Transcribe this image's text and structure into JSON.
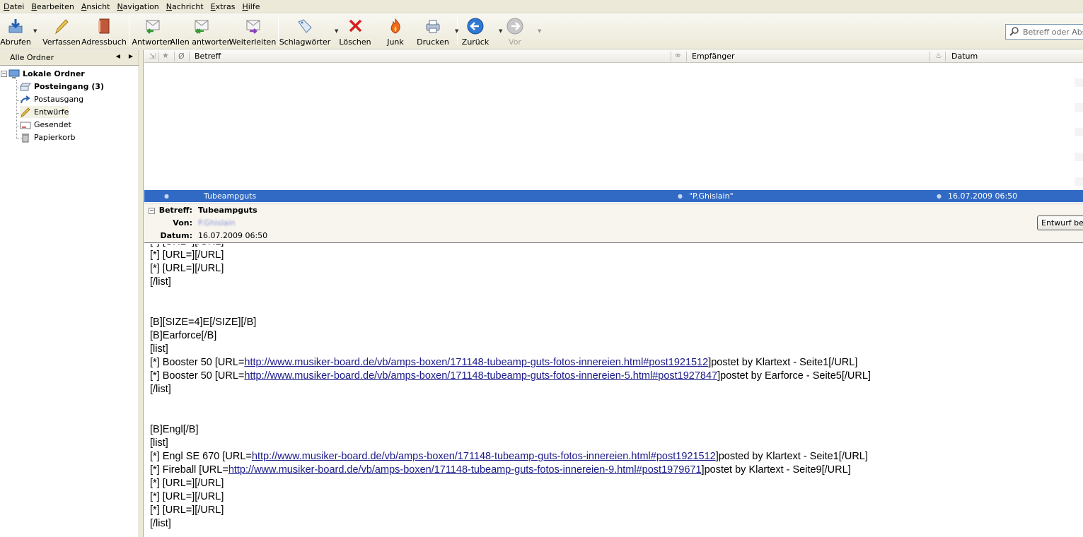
{
  "menu": [
    "Datei",
    "Bearbeiten",
    "Ansicht",
    "Navigation",
    "Nachricht",
    "Extras",
    "Hilfe"
  ],
  "toolbar": {
    "abrufen": "Abrufen",
    "verfassen": "Verfassen",
    "adressbuch": "Adressbuch",
    "antworten": "Antworten",
    "allen_antworten": "Allen antworten",
    "weiterleiten": "Weiterleiten",
    "schlagwoerter": "Schlagwörter",
    "loeschen": "Löschen",
    "junk": "Junk",
    "drucken": "Drucken",
    "zurueck": "Zurück",
    "vor": "Vor"
  },
  "search": {
    "placeholder": "Betreff oder Abs"
  },
  "folder_pane": {
    "header": "Alle Ordner",
    "root": "Lokale Ordner",
    "folders": [
      "Posteingang (3)",
      "Postausgang",
      "Entwürfe",
      "Gesendet",
      "Papierkorb"
    ]
  },
  "thread_columns": {
    "subject": "Betreff",
    "recipient": "Empfänger",
    "date": "Datum"
  },
  "selected_message": {
    "subject": "Tubeampguts",
    "recipient": "\"P.Ghislain\"",
    "date": "16.07.2009 06:50"
  },
  "message_header": {
    "subject_label": "Betreff:",
    "subject": "Tubeampguts",
    "from_label": "Von:",
    "from": "P.Ghislain",
    "date_label": "Datum:",
    "date": "16.07.2009 06:50",
    "edit_draft_button": "Entwurf bea"
  },
  "body_lines": [
    {
      "text": "[*] [URL=][/URL]"
    },
    {
      "text": "[*] [URL=][/URL]"
    },
    {
      "text": "[*] [URL=][/URL]"
    },
    {
      "text": "[/list]"
    },
    {
      "text": ""
    },
    {
      "text": ""
    },
    {
      "text": "[B][SIZE=4]E[/SIZE][/B]"
    },
    {
      "text": "[B]Earforce[/B]"
    },
    {
      "text": "[list]"
    },
    {
      "pre": "[*] Booster 50 [URL=",
      "link": "http://www.musiker-board.de/vb/amps-boxen/171148-tubeamp-guts-fotos-innereien.html#post1921512",
      "post": "]postet by Klartext - Seite1[/URL]"
    },
    {
      "pre": "[*] Booster 50 [URL=",
      "link": "http://www.musiker-board.de/vb/amps-boxen/171148-tubeamp-guts-fotos-innereien-5.html#post1927847",
      "post": "]postet by Earforce - Seite5[/URL]"
    },
    {
      "text": "[/list]"
    },
    {
      "text": ""
    },
    {
      "text": ""
    },
    {
      "text": "[B]Engl[/B]"
    },
    {
      "text": "[list]"
    },
    {
      "pre": "[*] Engl SE 670 [URL=",
      "link": "http://www.musiker-board.de/vb/amps-boxen/171148-tubeamp-guts-fotos-innereien.html#post1921512",
      "post": "]posted by Klartext - Seite1[/URL]"
    },
    {
      "pre": "[*] Fireball [URL=",
      "link": "http://www.musiker-board.de/vb/amps-boxen/171148-tubeamp-guts-fotos-innereien-9.html#post1979671",
      "post": "]postet by Klartext - Seite9[/URL]"
    },
    {
      "text": "[*] [URL=][/URL]"
    },
    {
      "text": "[*] [URL=][/URL]"
    },
    {
      "text": "[*] [URL=][/URL]"
    },
    {
      "text": "[/list]"
    }
  ]
}
